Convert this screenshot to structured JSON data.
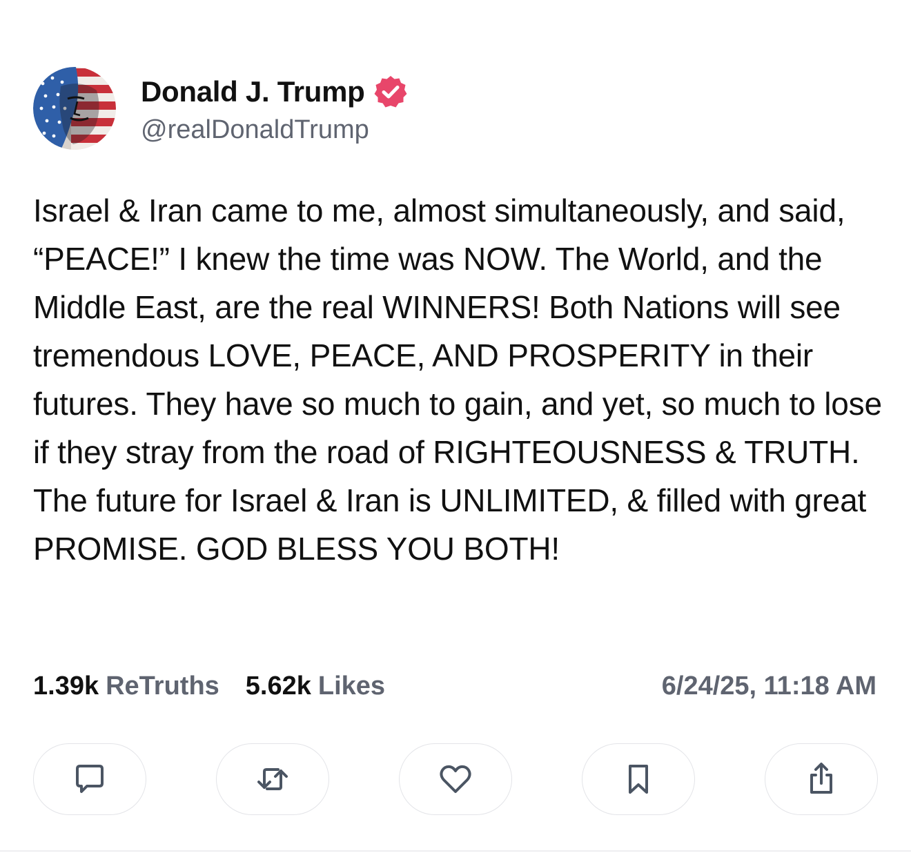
{
  "post": {
    "author": {
      "display_name": "Donald J. Trump",
      "handle": "@realDonaldTrump",
      "verified_icon": "verified-badge-icon",
      "avatar_icon": "avatar-image"
    },
    "text": "Israel & Iran came to me, almost simultaneously, and said, “PEACE!” I knew the time was NOW. The World, and the Middle East, are the real WINNERS! Both Nations will see tremendous LOVE, PEACE, AND PROSPERITY in their futures. They have so much to gain, and yet, so much to lose if they stray from the road of RIGHTEOUSNESS & TRUTH. The future for Israel & Iran is UNLIMITED, & filled with great PROMISE. GOD BLESS YOU BOTH!",
    "stats": {
      "retruths_count": "1.39k",
      "retruths_label": "ReTruths",
      "likes_count": "5.62k",
      "likes_label": "Likes"
    },
    "timestamp": "6/24/25, 11:18 AM"
  },
  "actions": [
    {
      "name": "reply",
      "icon": "comment-icon"
    },
    {
      "name": "retruth",
      "icon": "repost-icon"
    },
    {
      "name": "like",
      "icon": "heart-icon"
    },
    {
      "name": "bookmark",
      "icon": "bookmark-icon"
    },
    {
      "name": "share",
      "icon": "share-icon"
    }
  ],
  "colors": {
    "verified_badge": "#e8466a",
    "text_primary": "#111111",
    "text_secondary": "#5f6470",
    "button_border": "#e3e4e8",
    "icon_stroke": "#4b5563"
  }
}
